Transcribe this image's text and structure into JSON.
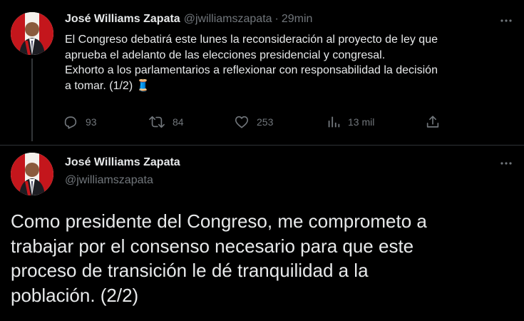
{
  "tweet1": {
    "display_name": "José Williams Zapata",
    "handle": "@jwilliamszapata",
    "separator": "·",
    "time": "29min",
    "text_lines": [
      "El Congreso debatirá este lunes la reconsideración al proyecto de ley que",
      "aprueba el adelanto de las elecciones presidencial y congresal.",
      "Exhorto a los parlamentarios a reflexionar con responsabilidad la decisión",
      "a tomar. (1/2) 🧵"
    ],
    "actions": {
      "replies": "93",
      "retweets": "84",
      "likes": "253",
      "views": "13 mil"
    }
  },
  "tweet2": {
    "display_name": "José Williams Zapata",
    "handle": "@jwilliamszapata",
    "text_lines": [
      "Como presidente del Congreso, me comprometo a",
      "trabajar por el consenso necesario para que este",
      "proceso de transición le dé tranquilidad a la",
      "población. (2/2)"
    ]
  },
  "icons": {
    "more": "more-horizontal-icon",
    "reply": "reply-icon",
    "retweet": "retweet-icon",
    "like": "heart-icon",
    "views": "analytics-icon",
    "share": "share-icon"
  },
  "colors": {
    "background": "#000000",
    "text_primary": "#e7e9ea",
    "text_secondary": "#71767b",
    "divider": "#2f3336"
  }
}
